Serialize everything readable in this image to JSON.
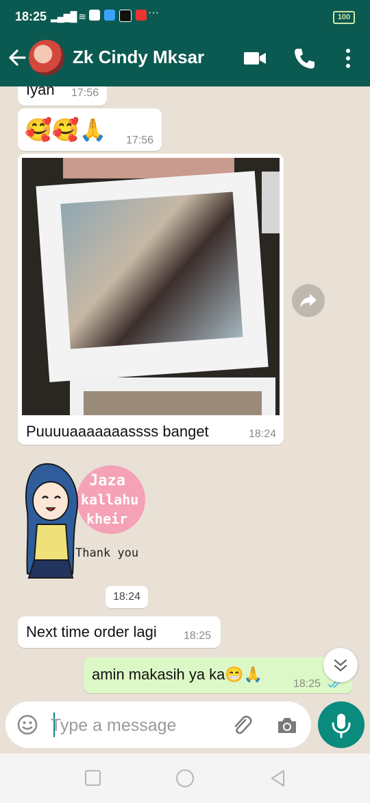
{
  "status_bar": {
    "time": "18:25",
    "more": "···",
    "battery": "100"
  },
  "header": {
    "contact_name": "Zk Cindy Mksar"
  },
  "messages": [
    {
      "text": "Iyah",
      "time": "17:56"
    },
    {
      "text": "🥰🥰🙏",
      "time": "17:56"
    },
    {
      "caption": "Puuuuaaaaaaassss banget",
      "time": "18:24"
    },
    {
      "sticker_text": [
        "Jaza",
        "kallahu",
        "kheir",
        "Thank you"
      ]
    },
    {
      "time": "18:24"
    },
    {
      "text": "Next time order lagi",
      "time": "18:25"
    },
    {
      "text": "amin makasih ya ka😁🙏",
      "time": "18:25",
      "status": "read"
    }
  ],
  "composer": {
    "placeholder": "Type a message"
  },
  "colors": {
    "header": "#0b5a51",
    "accent": "#0b8a7e",
    "outgoing_bubble": "#dcf8c6",
    "read_ticks": "#4fb7ec"
  }
}
